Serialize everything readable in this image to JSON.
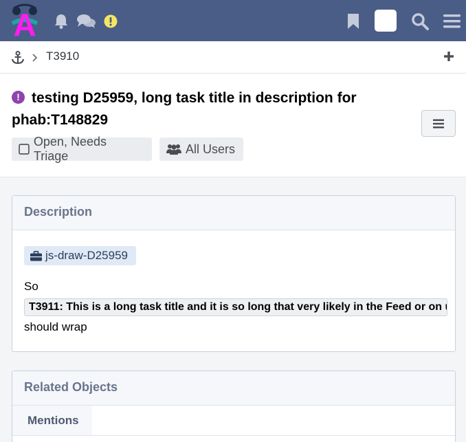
{
  "topbar": {
    "logo_letter": "A",
    "icons": [
      "bell-icon",
      "chat-icon",
      "alert-icon",
      "bookmark-icon",
      "search-icon",
      "menu-icon"
    ],
    "alert_color": "#f5e663",
    "background": "#4a5d86"
  },
  "breadcrumb": {
    "items": [
      "T3910"
    ],
    "icons": [
      "anchor-icon",
      "chevron-right-icon",
      "plus-icon"
    ]
  },
  "task": {
    "title": "testing D25959, long task title in description for phab:T148829",
    "status": "Open, Needs Triage",
    "visibility": "All Users",
    "icon_color": "#8e44ad"
  },
  "description": {
    "heading": "Description",
    "project_tag": "js-draw-D25959",
    "line1": "So",
    "task_ref": "T3911: This is a long task title and it is so long that very likely in the Feed or on u",
    "line2": "should wrap"
  },
  "related": {
    "heading": "Related Objects",
    "tabs": [
      "Mentions"
    ]
  }
}
